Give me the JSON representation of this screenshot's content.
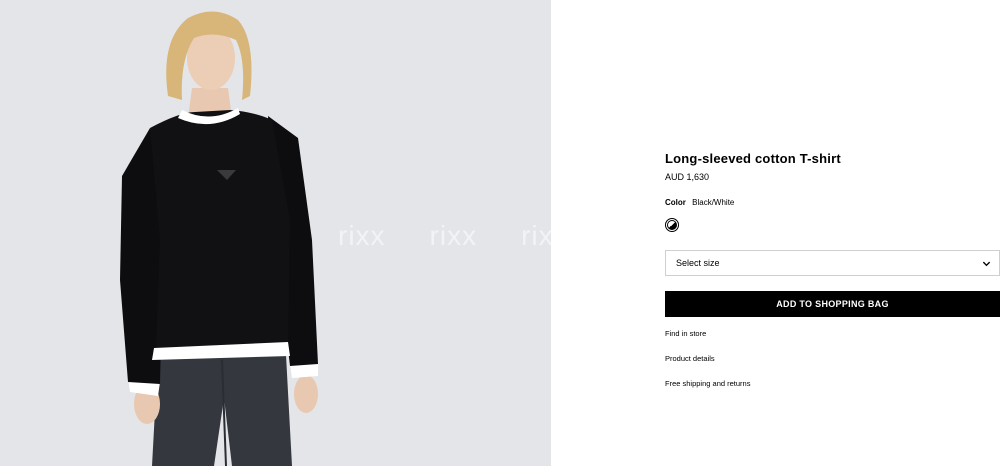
{
  "product": {
    "title": "Long-sleeved cotton T-shirt",
    "price": "AUD 1,630",
    "color_label": "Color",
    "color_value": "Black/White",
    "swatch_color": "black-white"
  },
  "image": {
    "background_color": "#e4e5e9",
    "watermark": [
      "rixx",
      "rixx",
      "rixx"
    ]
  },
  "size_select": {
    "label": "Select size",
    "icon": "chevron-down-icon"
  },
  "actions": {
    "add_to_bag": "ADD TO SHOPPING BAG"
  },
  "links": {
    "find_in_store": "Find in store",
    "product_details": "Product details",
    "shipping": "Free shipping and returns"
  }
}
